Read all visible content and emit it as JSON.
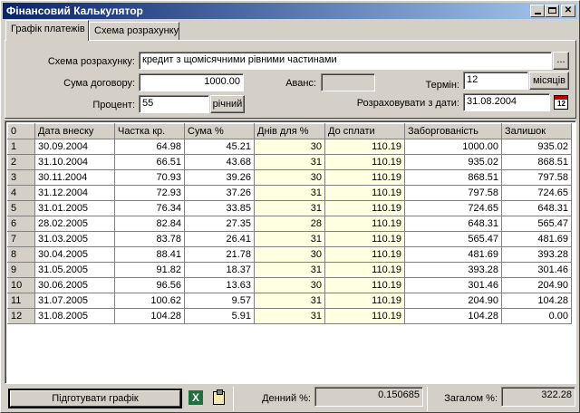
{
  "window": {
    "title": "Фінансовий Калькулятор",
    "minimize_glyph": "",
    "maximize_glyph": "",
    "close_glyph": "✕"
  },
  "tabs": [
    {
      "label": "Графік платежів",
      "active": true
    },
    {
      "label": "Схема розрахунку",
      "active": false
    }
  ],
  "form": {
    "scheme_label": "Схема розрахунку:",
    "scheme_value": "кредит з щомісячними рівними частинами",
    "scheme_browse": "...",
    "amount_label": "Сума договору:",
    "amount_value": "1000.00",
    "advance_label": "Аванс:",
    "advance_value": "",
    "term_label": "Термін:",
    "term_value": "12",
    "term_unit": "місяців",
    "percent_label": "Процент:",
    "percent_value": "55",
    "percent_unit": "річний",
    "calc_date_label": "Розраховувати з дати:",
    "calc_date_value": "31.08.2004",
    "calendar_icon_text": "12"
  },
  "grid": {
    "columns": [
      "0",
      "Дата внеску",
      "Частка кр.",
      "Сума %",
      "Днів для %",
      "До сплати",
      "Заборгованість",
      "Залишок"
    ],
    "rows": [
      [
        "1",
        "30.09.2004",
        "64.98",
        "45.21",
        "30",
        "110.19",
        "1000.00",
        "935.02"
      ],
      [
        "2",
        "31.10.2004",
        "66.51",
        "43.68",
        "31",
        "110.19",
        "935.02",
        "868.51"
      ],
      [
        "3",
        "30.11.2004",
        "70.93",
        "39.26",
        "30",
        "110.19",
        "868.51",
        "797.58"
      ],
      [
        "4",
        "31.12.2004",
        "72.93",
        "37.26",
        "31",
        "110.19",
        "797.58",
        "724.65"
      ],
      [
        "5",
        "31.01.2005",
        "76.34",
        "33.85",
        "31",
        "110.19",
        "724.65",
        "648.31"
      ],
      [
        "6",
        "28.02.2005",
        "82.84",
        "27.35",
        "28",
        "110.19",
        "648.31",
        "565.47"
      ],
      [
        "7",
        "31.03.2005",
        "83.78",
        "26.41",
        "31",
        "110.19",
        "565.47",
        "481.69"
      ],
      [
        "8",
        "30.04.2005",
        "88.41",
        "21.78",
        "30",
        "110.19",
        "481.69",
        "393.28"
      ],
      [
        "9",
        "31.05.2005",
        "91.82",
        "18.37",
        "31",
        "110.19",
        "393.28",
        "301.46"
      ],
      [
        "10",
        "30.06.2005",
        "96.56",
        "13.63",
        "30",
        "110.19",
        "301.46",
        "204.90"
      ],
      [
        "11",
        "31.07.2005",
        "100.62",
        "9.57",
        "31",
        "110.19",
        "204.90",
        "104.28"
      ],
      [
        "12",
        "31.08.2005",
        "104.28",
        "5.91",
        "31",
        "110.19",
        "104.28",
        "0.00"
      ]
    ]
  },
  "footer": {
    "prepare_button": "Підготувати графік",
    "excel_icon_text": "X",
    "daily_label": "Денний %:",
    "daily_value": "0.150685",
    "total_label": "Загалом %:",
    "total_value": "322.28"
  },
  "colors": {
    "title_gradient_start": "#0a246a",
    "title_gradient_end": "#a6caf0",
    "highlight_column": "#ffffe1",
    "face": "#d4d0c8"
  }
}
